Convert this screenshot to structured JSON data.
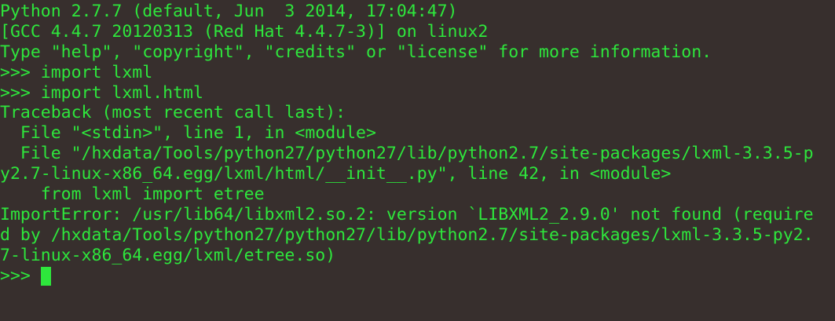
{
  "terminal": {
    "lines": [
      "Python 2.7.7 (default, Jun  3 2014, 17:04:47)",
      "[GCC 4.4.7 20120313 (Red Hat 4.4.7-3)] on linux2",
      "Type \"help\", \"copyright\", \"credits\" or \"license\" for more information.",
      ">>> import lxml",
      ">>> import lxml.html",
      "Traceback (most recent call last):",
      "  File \"<stdin>\", line 1, in <module>",
      "  File \"/hxdata/Tools/python27/python27/lib/python2.7/site-packages/lxml-3.3.5-p",
      "y2.7-linux-x86_64.egg/lxml/html/__init__.py\", line 42, in <module>",
      "    from lxml import etree",
      "ImportError: /usr/lib64/libxml2.so.2: version `LIBXML2_2.9.0' not found (require",
      "d by /hxdata/Tools/python27/python27/lib/python2.7/site-packages/lxml-3.3.5-py2.",
      "7-linux-x86_64.egg/lxml/etree.so)"
    ],
    "prompt": ">>> ",
    "colors": {
      "background": "#372f2d",
      "text": "#2ee63c"
    }
  }
}
